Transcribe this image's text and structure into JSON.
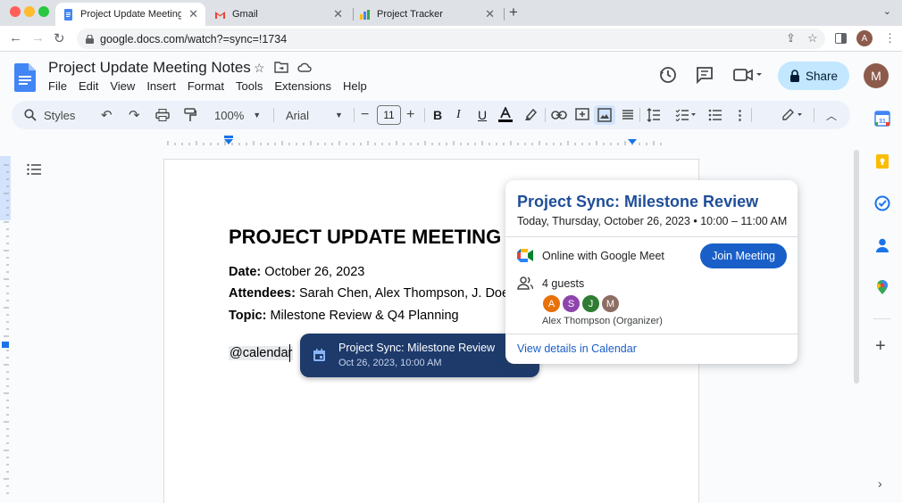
{
  "browser": {
    "tabs": [
      {
        "title": "Project Update Meeting No",
        "active": true
      },
      {
        "title": "Gmail",
        "active": false
      },
      {
        "title": "Project Tracker",
        "active": false
      }
    ],
    "new_tab_label": "+",
    "url": "google.docs.com/watch?=sync=!1734",
    "profile_initial": "A"
  },
  "docs": {
    "title": "Project Update Meeting Notes",
    "menu": [
      "File",
      "Edit",
      "View",
      "Insert",
      "Format",
      "Tools",
      "Extensions",
      "Help"
    ],
    "share_label": "Share",
    "account_initial": "M"
  },
  "toolbar": {
    "styles_label": "Styles",
    "zoom": "100%",
    "font": "Arial",
    "font_size": "11"
  },
  "document": {
    "heading": "PROJECT UPDATE MEETING",
    "date_label": "Date:",
    "date_value": " October 26, 2023",
    "attendees_label": "Attendees:",
    "attendees_value": " Sarah Chen, Alex Thompson, J. Doe",
    "topic_label": "Topic:",
    "topic_value": " Milestone Review & Q4 Planning",
    "mention_text": "@calendar"
  },
  "suggestion": {
    "title": "Project Sync: Milestone Review",
    "subtitle": "Oct 26, 2023, 10:00 AM"
  },
  "event_card": {
    "title": "Project Sync: Milestone Review",
    "when": "Today, Thursday, October 26, 2023 • 10:00 – 11:00 AM",
    "meet_text": "Online with Google Meet",
    "join_label": "Join Meeting",
    "guests_text": "4 guests",
    "guests": [
      {
        "initial": "A",
        "color": "#e8710a"
      },
      {
        "initial": "S",
        "color": "#8e44ad"
      },
      {
        "initial": "J",
        "color": "#2e7d32"
      },
      {
        "initial": "M",
        "color": "#8d6e63"
      }
    ],
    "organizer": "Alex Thompson (Organizer)",
    "view_link": "View details in Calendar"
  },
  "colors": {
    "accent_blue": "#1a5fc8",
    "share_bg": "#c2e7ff",
    "suggest_bg": "#1d3a6b"
  }
}
